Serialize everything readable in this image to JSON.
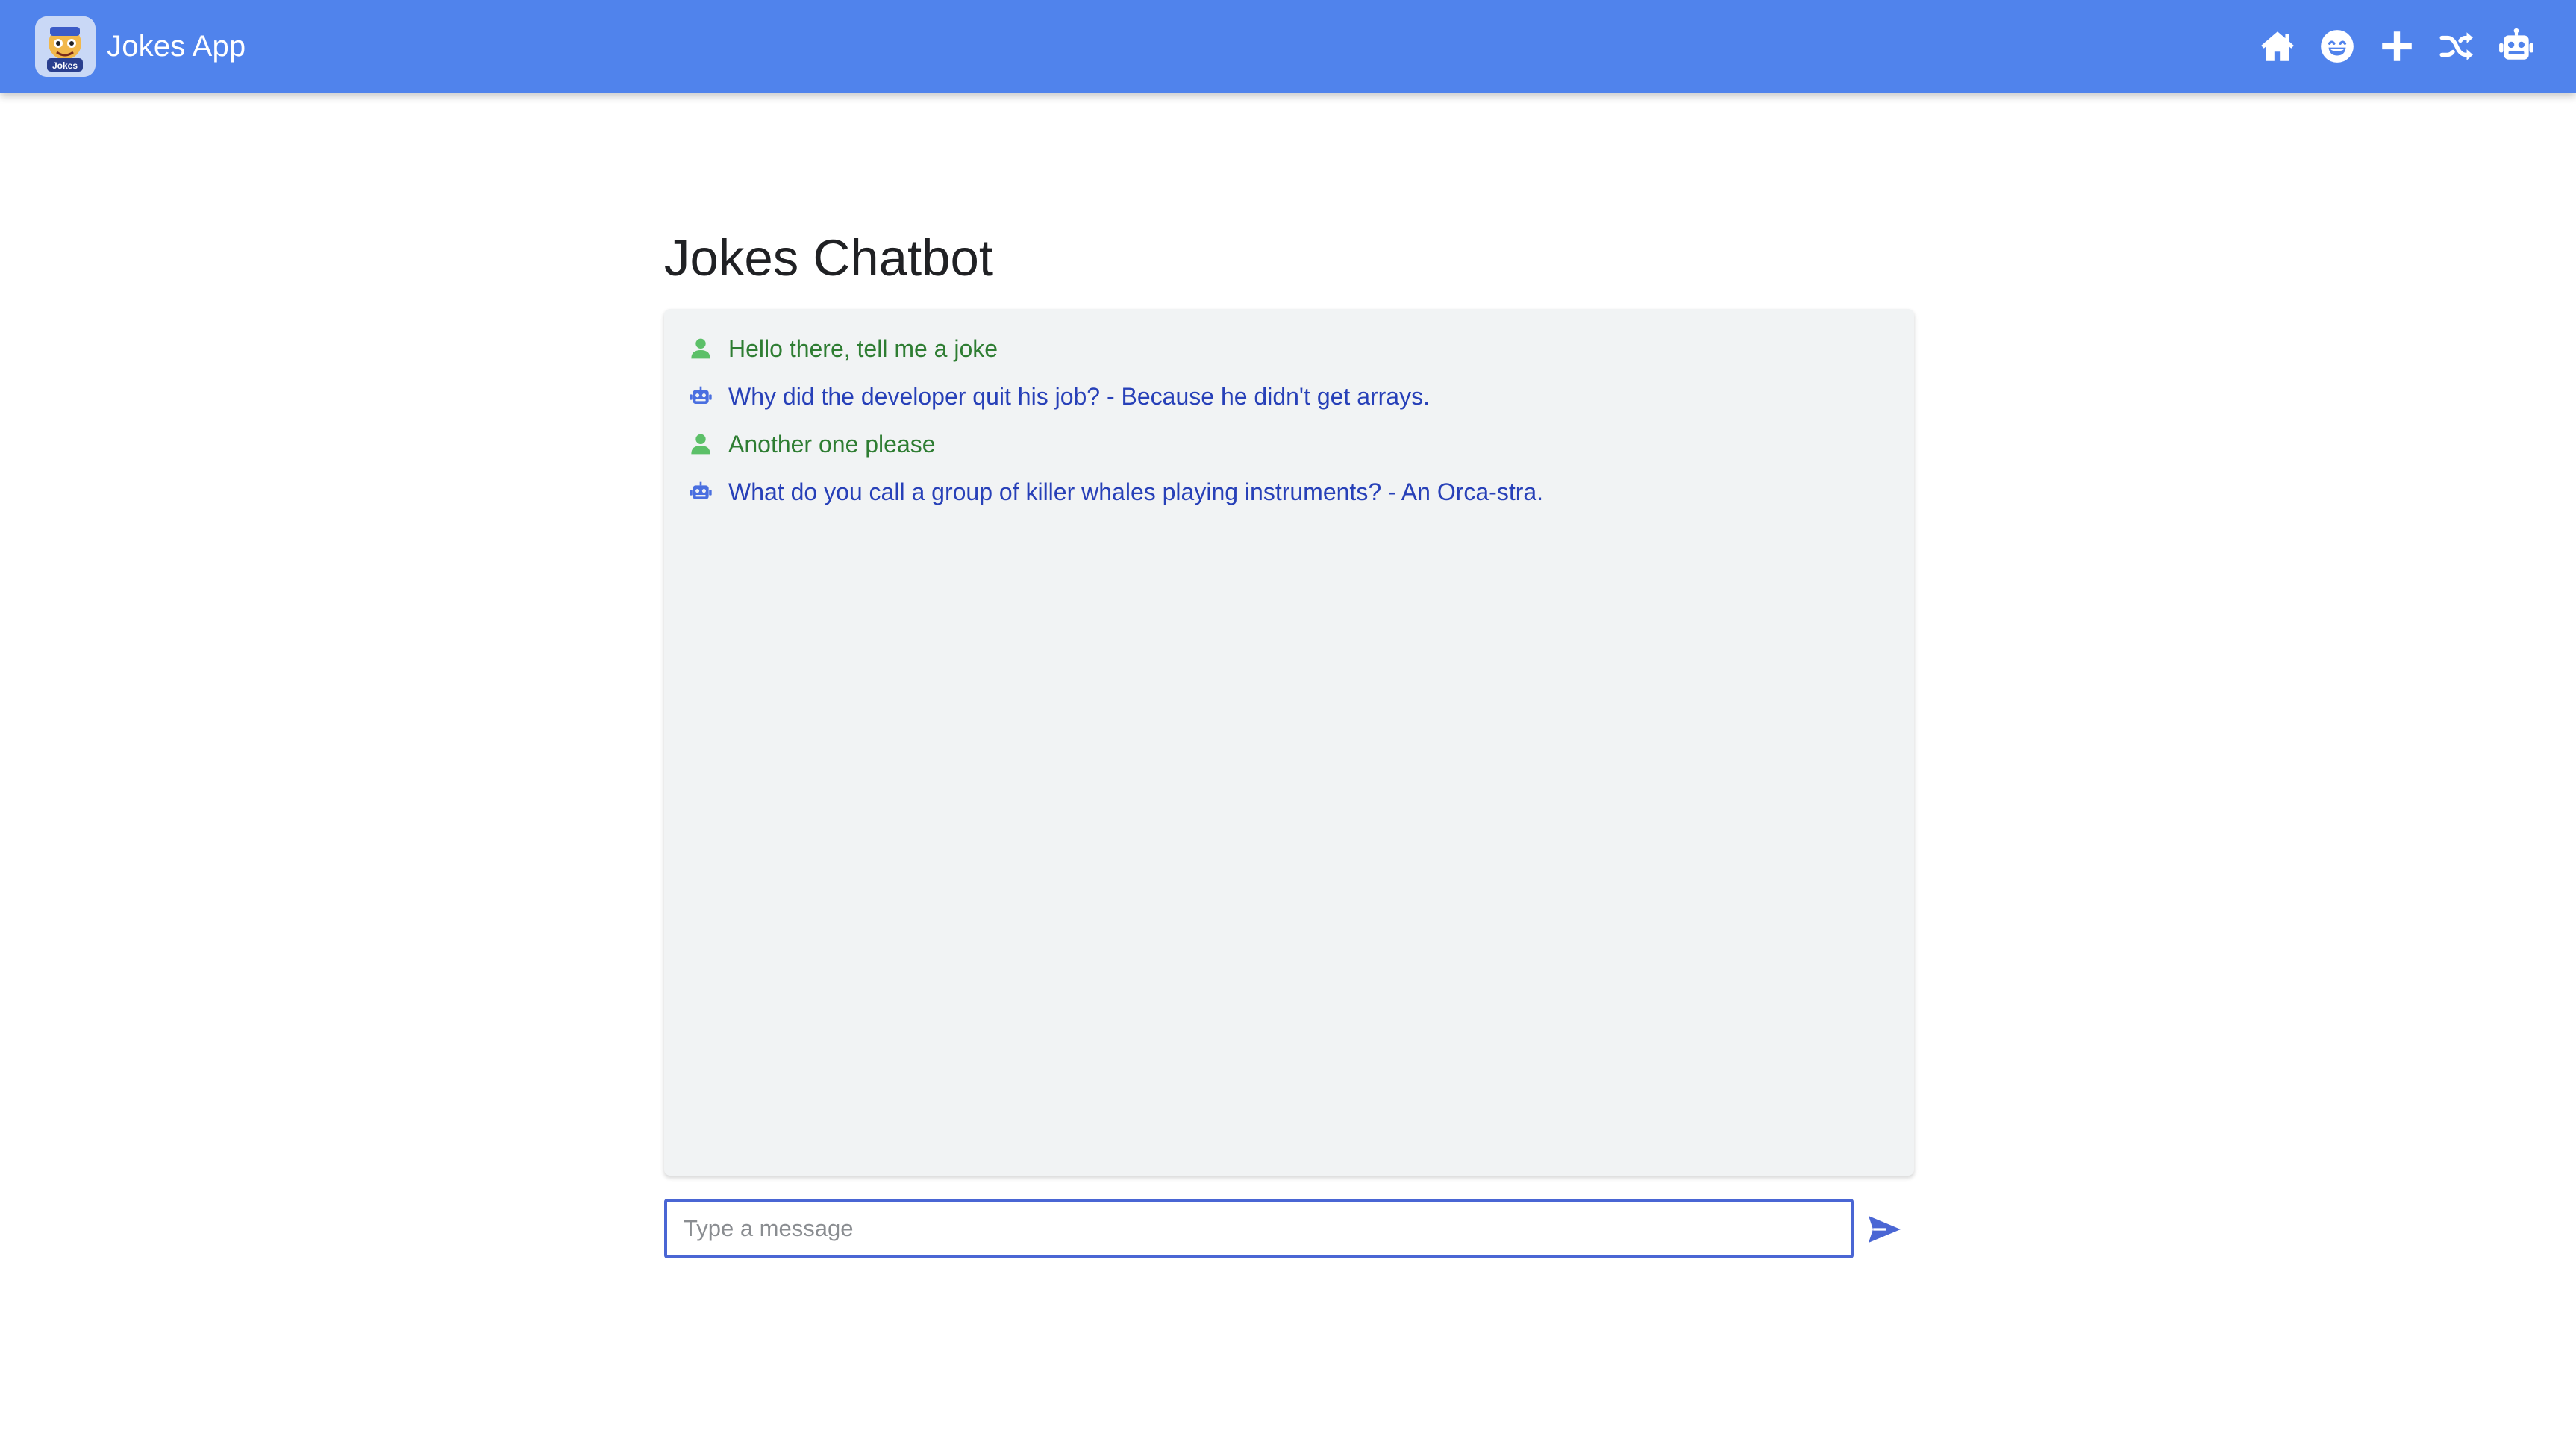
{
  "app": {
    "title": "Jokes App",
    "logo_icon": "jokes-app-logo",
    "brand_color": "#5083ec"
  },
  "nav": {
    "items": [
      {
        "icon": "home-icon"
      },
      {
        "icon": "smile-icon"
      },
      {
        "icon": "plus-icon"
      },
      {
        "icon": "shuffle-icon"
      },
      {
        "icon": "robot-icon"
      }
    ]
  },
  "main": {
    "title": "Jokes Chatbot"
  },
  "chat": {
    "messages": [
      {
        "sender": "user",
        "icon": "user-icon",
        "text": "Hello there, tell me a joke",
        "color": "#2e7d32"
      },
      {
        "sender": "bot",
        "icon": "robot-icon",
        "text": "Why did the developer quit his job? - Because he didn't get arrays.",
        "color": "#2740b8"
      },
      {
        "sender": "user",
        "icon": "user-icon",
        "text": "Another one please",
        "color": "#2e7d32"
      },
      {
        "sender": "bot",
        "icon": "robot-icon",
        "text": "What do you call a group of killer whales playing instruments? - An Orca-stra.",
        "color": "#2740b8"
      }
    ]
  },
  "composer": {
    "placeholder": "Type a message",
    "value": "",
    "send_icon": "send-icon",
    "accent": "#4a66d4"
  }
}
